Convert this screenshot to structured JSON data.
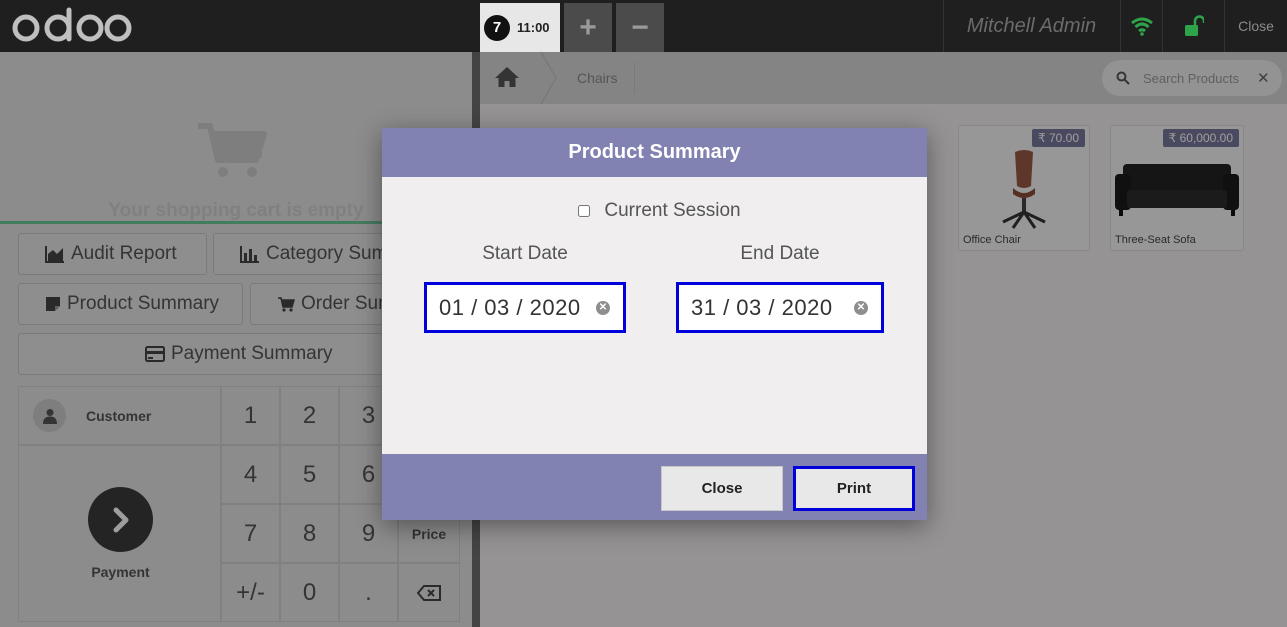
{
  "header": {
    "logo_text": "odoo",
    "order": {
      "number": "7",
      "time": "11:00"
    },
    "add_tab": "+",
    "remove_tab": "−",
    "user_name": "Mitchell Admin",
    "close_label": "Close",
    "wifi_icon": "wifi-icon",
    "lock_icon": "unlock-icon",
    "status_color": "#2fa34a"
  },
  "cart": {
    "empty_message": "Your shopping cart is empty"
  },
  "controls": {
    "audit_report": "Audit Report",
    "category_summary": "Category Summary",
    "product_summary": "Product Summary",
    "order_summary": "Order Summary",
    "payment_summary": "Payment Summary"
  },
  "numpad": {
    "customer": "Customer",
    "payment": "Payment",
    "keys": [
      "1",
      "2",
      "3",
      "4",
      "5",
      "6",
      "7",
      "8",
      "9",
      "+/-",
      "0",
      "."
    ],
    "price": "Price"
  },
  "breadcrumb": {
    "category": "Chairs"
  },
  "search": {
    "placeholder": "Search Products"
  },
  "products": [
    {
      "name": "Office Chair",
      "price": "₹ 70.00"
    },
    {
      "name": "Three-Seat Sofa",
      "price": "₹ 60,000.00"
    }
  ],
  "modal": {
    "title": "Product Summary",
    "current_session": "Current Session",
    "start_date_label": "Start Date",
    "end_date_label": "End Date",
    "start_date": "01 / 03 / 2020",
    "end_date": "31 / 03 / 2020",
    "close_button": "Close",
    "print_button": "Print",
    "accent_color": "#8181b2",
    "focus_color": "#0000dd"
  }
}
